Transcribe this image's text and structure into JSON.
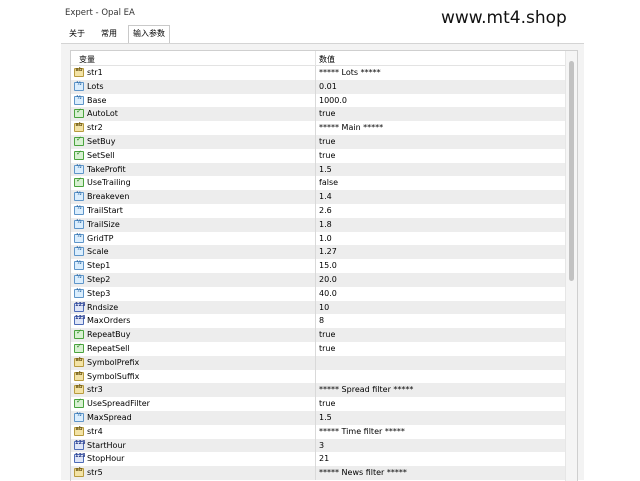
{
  "window": {
    "title": "Expert - Opal EA",
    "watermark": "www.mt4.shop"
  },
  "tabs": [
    {
      "label": "关于",
      "active": false
    },
    {
      "label": "常用",
      "active": false
    },
    {
      "label": "输入参数",
      "active": true
    }
  ],
  "grid": {
    "col_variable": "变量",
    "col_value": "数值",
    "rows": [
      {
        "name": "str1",
        "value": "***** Lots *****",
        "type": "str",
        "icon": "string-icon",
        "badge": "ab"
      },
      {
        "name": "Lots",
        "value": "0.01",
        "type": "dbl",
        "icon": "double-icon",
        "badge": "½"
      },
      {
        "name": "Base",
        "value": "1000.0",
        "type": "dbl",
        "icon": "double-icon",
        "badge": "½"
      },
      {
        "name": "AutoLot",
        "value": "true",
        "type": "bool",
        "icon": "bool-icon",
        "badge": "✓"
      },
      {
        "name": "str2",
        "value": "***** Main *****",
        "type": "str",
        "icon": "string-icon",
        "badge": "ab"
      },
      {
        "name": "SetBuy",
        "value": "true",
        "type": "bool",
        "icon": "bool-icon",
        "badge": "✓"
      },
      {
        "name": "SetSell",
        "value": "true",
        "type": "bool",
        "icon": "bool-icon",
        "badge": "✓"
      },
      {
        "name": "TakeProfit",
        "value": "1.5",
        "type": "dbl",
        "icon": "double-icon",
        "badge": "½"
      },
      {
        "name": "UseTrailing",
        "value": "false",
        "type": "bool",
        "icon": "bool-icon",
        "badge": "✓"
      },
      {
        "name": "Breakeven",
        "value": "1.4",
        "type": "dbl",
        "icon": "double-icon",
        "badge": "½"
      },
      {
        "name": "TrailStart",
        "value": "2.6",
        "type": "dbl",
        "icon": "double-icon",
        "badge": "½"
      },
      {
        "name": "TrailSize",
        "value": "1.8",
        "type": "dbl",
        "icon": "double-icon",
        "badge": "½"
      },
      {
        "name": "GridTP",
        "value": "1.0",
        "type": "dbl",
        "icon": "double-icon",
        "badge": "½"
      },
      {
        "name": "Scale",
        "value": "1.27",
        "type": "dbl",
        "icon": "double-icon",
        "badge": "½"
      },
      {
        "name": "Step1",
        "value": "15.0",
        "type": "dbl",
        "icon": "double-icon",
        "badge": "½"
      },
      {
        "name": "Step2",
        "value": "20.0",
        "type": "dbl",
        "icon": "double-icon",
        "badge": "½"
      },
      {
        "name": "Step3",
        "value": "40.0",
        "type": "dbl",
        "icon": "double-icon",
        "badge": "½"
      },
      {
        "name": "Rndsize",
        "value": "10",
        "type": "int",
        "icon": "int-icon",
        "badge": "123"
      },
      {
        "name": "MaxOrders",
        "value": "8",
        "type": "int",
        "icon": "int-icon",
        "badge": "123"
      },
      {
        "name": "RepeatBuy",
        "value": "true",
        "type": "bool",
        "icon": "bool-icon",
        "badge": "✓"
      },
      {
        "name": "RepeatSell",
        "value": "true",
        "type": "bool",
        "icon": "bool-icon",
        "badge": "✓"
      },
      {
        "name": "SymbolPrefix",
        "value": "",
        "type": "str",
        "icon": "string-icon",
        "badge": "ab"
      },
      {
        "name": "SymbolSuffix",
        "value": "",
        "type": "str",
        "icon": "string-icon",
        "badge": "ab"
      },
      {
        "name": "str3",
        "value": "***** Spread filter *****",
        "type": "str",
        "icon": "string-icon",
        "badge": "ab"
      },
      {
        "name": "UseSpreadFilter",
        "value": "true",
        "type": "bool",
        "icon": "bool-icon",
        "badge": "✓"
      },
      {
        "name": "MaxSpread",
        "value": "1.5",
        "type": "dbl",
        "icon": "double-icon",
        "badge": "½"
      },
      {
        "name": "str4",
        "value": "***** Time filter *****",
        "type": "str",
        "icon": "string-icon",
        "badge": "ab"
      },
      {
        "name": "StartHour",
        "value": "3",
        "type": "int",
        "icon": "int-icon",
        "badge": "123"
      },
      {
        "name": "StopHour",
        "value": "21",
        "type": "int",
        "icon": "int-icon",
        "badge": "123"
      },
      {
        "name": "str5",
        "value": "***** News filter *****",
        "type": "str",
        "icon": "string-icon",
        "badge": "ab"
      }
    ]
  }
}
